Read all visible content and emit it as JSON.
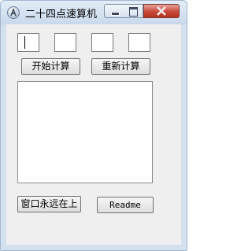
{
  "window": {
    "title": "二十四点速算机"
  },
  "inputs": {
    "digits": [
      "",
      "",
      "",
      ""
    ]
  },
  "buttons": {
    "start_label": "开始计算",
    "reset_label": "重新计算",
    "topmost_label": "窗口永远在上",
    "readme_label": "Readme"
  },
  "output": {
    "text": ""
  },
  "icons": {
    "app": "app-icon",
    "minimize": "minimize-icon",
    "maximize": "maximize-icon",
    "close": "close-icon"
  }
}
